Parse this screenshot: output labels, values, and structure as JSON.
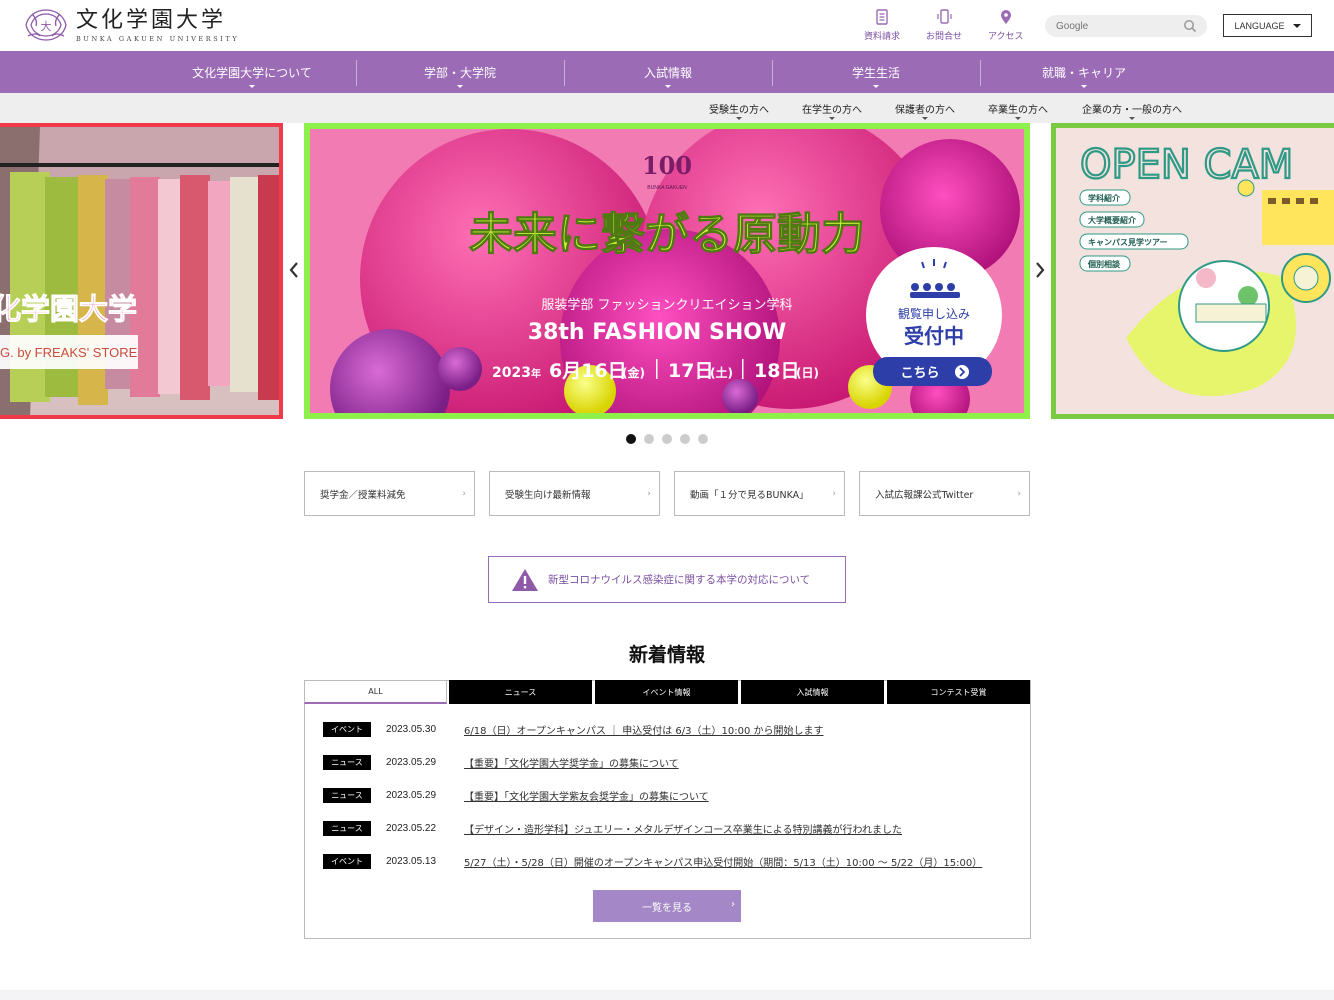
{
  "header": {
    "logo_jp": "文化学園大学",
    "logo_en": "BUNKA GAKUEN UNIVERSITY",
    "utility_links": [
      {
        "label": "資料請求",
        "icon": "document-icon"
      },
      {
        "label": "お問合せ",
        "icon": "phone-icon"
      },
      {
        "label": "アクセス",
        "icon": "map-pin-icon"
      }
    ],
    "search_placeholder": "Google",
    "language_label": "LANGUAGE"
  },
  "main_nav": [
    "文化学園大学について",
    "学部・大学院",
    "入試情報",
    "学生生活",
    "就職・キャリア"
  ],
  "sub_nav": [
    "受験生の方へ",
    "在学生の方へ",
    "保護者の方へ",
    "卒業生の方へ",
    "企業の方・一般の方へ"
  ],
  "carousel": {
    "left": {
      "text_a": "化学園大学",
      "text_b": "G. by FREAKS' STORE"
    },
    "center": {
      "logo": "100",
      "logo_sub": "BUNKA GAKUEN",
      "headline": "未来に繋がる原動力",
      "dept": "服装学部 ファッションクリエイション学科",
      "show": "38th FASHION SHOW",
      "date_year": "2023",
      "date_year_suffix": "年",
      "date_1": "6月16日",
      "dow_1": "(金)",
      "date_2": "17日",
      "dow_2": "(土)",
      "date_3": "18日",
      "dow_3": "(日)",
      "badge_line1": "観覧申し込み",
      "badge_line2": "受付中",
      "badge_cta": "こちら"
    },
    "right": {
      "title": "OPEN CAM",
      "items": [
        "学科紹介",
        "大学概要紹介",
        "キャンパス見学ツアー",
        "個別相談"
      ]
    },
    "dots_total": 5,
    "dot_active": 0
  },
  "quick_links": [
    "奨学金／授業料減免",
    "受験生向け最新情報",
    "動画「１分で見るBUNKA」",
    "入試広報課公式Twitter"
  ],
  "alert_text": "新型コロナウイルス感染症に関する本学の対応について",
  "news": {
    "title": "新着情報",
    "tabs": [
      "ALL",
      "ニュース",
      "イベント情報",
      "入試情報",
      "コンテスト受賞"
    ],
    "active_tab": "ALL",
    "items": [
      {
        "badge": "イベント",
        "date": "2023.05.30",
        "title": "6/18（日）オープンキャンパス ｜ 申込受付は 6/3（土）10:00 から開始します"
      },
      {
        "badge": "ニュース",
        "date": "2023.05.29",
        "title": "【重要】「文化学園大学奨学金」の募集について"
      },
      {
        "badge": "ニュース",
        "date": "2023.05.29",
        "title": "【重要】「文化学園大学紫友会奨学金」の募集について"
      },
      {
        "badge": "ニュース",
        "date": "2023.05.22",
        "title": "【デザイン・造形学科】ジュエリー・メタルデザインコース卒業生による特別講義が行われました"
      },
      {
        "badge": "イベント",
        "date": "2023.05.13",
        "title": "5/27（土）・5/28（日）開催のオープンキャンパス申込受付開始（期間：5/13（土）10:00 ～ 5/22（月）15:00）"
      }
    ],
    "more_label": "一覧を見る"
  },
  "colors": {
    "brand_purple": "#9b6bb5",
    "button_purple": "#a487c6",
    "slide_center_frame": "#8ef04a"
  }
}
